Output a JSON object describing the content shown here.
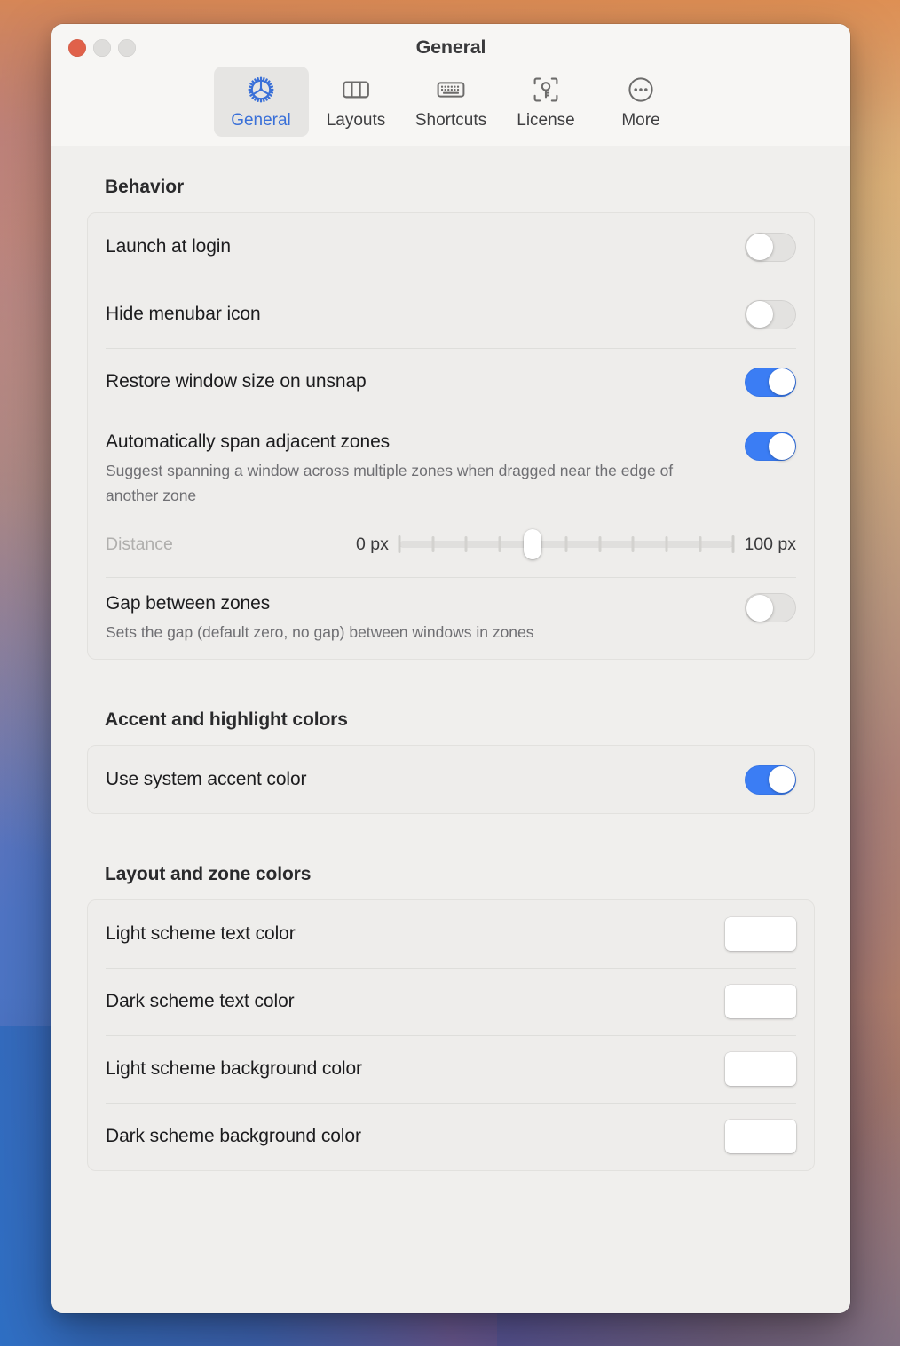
{
  "window": {
    "title": "General",
    "traffic_lights": [
      {
        "name": "close",
        "color": "#e0614a"
      },
      {
        "name": "minimize",
        "color": "#dedddb"
      },
      {
        "name": "zoom",
        "color": "#dedddb"
      }
    ]
  },
  "toolbar": {
    "tabs": [
      {
        "label": "General",
        "icon": "gear-icon",
        "selected": true
      },
      {
        "label": "Layouts",
        "icon": "columns-icon",
        "selected": false
      },
      {
        "label": "Shortcuts",
        "icon": "keyboard-icon",
        "selected": false
      },
      {
        "label": "License",
        "icon": "key-scan-icon",
        "selected": false
      },
      {
        "label": "More",
        "icon": "ellipsis-circle-icon",
        "selected": false
      }
    ]
  },
  "sections": {
    "behavior": {
      "title": "Behavior",
      "rows": {
        "launch_at_login": {
          "label": "Launch at login",
          "toggle": "off"
        },
        "hide_menubar_icon": {
          "label": "Hide menubar icon",
          "toggle": "off"
        },
        "restore_window_size": {
          "label": "Restore window size on unsnap",
          "toggle": "on"
        },
        "span_adjacent_zones": {
          "label": "Automatically span adjacent zones",
          "subtitle": "Suggest spanning a window across multiple zones when dragged near the edge of another zone",
          "toggle": "on",
          "slider": {
            "label": "Distance",
            "min_label": "0 px",
            "max_label": "100 px",
            "min": 0,
            "max": 100,
            "value": 40,
            "ticks": 11
          }
        },
        "gap_between_zones": {
          "label": "Gap between zones",
          "subtitle": "Sets the gap (default zero, no gap) between windows in zones",
          "toggle": "off"
        }
      }
    },
    "accent": {
      "title": "Accent and highlight colors",
      "rows": {
        "use_system_accent": {
          "label": "Use system accent color",
          "toggle": "on"
        }
      }
    },
    "layout_colors": {
      "title": "Layout and zone colors",
      "rows": {
        "light_text": {
          "label": "Light scheme text color",
          "well": "solid",
          "color_a": "#000000",
          "color_b": "#000000"
        },
        "dark_text": {
          "label": "Dark scheme text color",
          "well": "solid",
          "color_a": "#ffffff",
          "color_b": "#ffffff"
        },
        "light_bg": {
          "label": "Light scheme background color",
          "well": "diagonal",
          "color_a": "#7e7e7e",
          "color_b": "#ffffff"
        },
        "dark_bg": {
          "label": "Dark scheme background color",
          "well": "diagonal",
          "color_a": "#000000",
          "color_b": "#828282"
        }
      }
    }
  },
  "theme": {
    "accent_blue": "#3b7df4",
    "tab_selected_blue": "#3a70d8",
    "window_bg": "#f0efed",
    "group_bg": "#eeedeb",
    "toolbar_bg": "#f7f6f4"
  }
}
